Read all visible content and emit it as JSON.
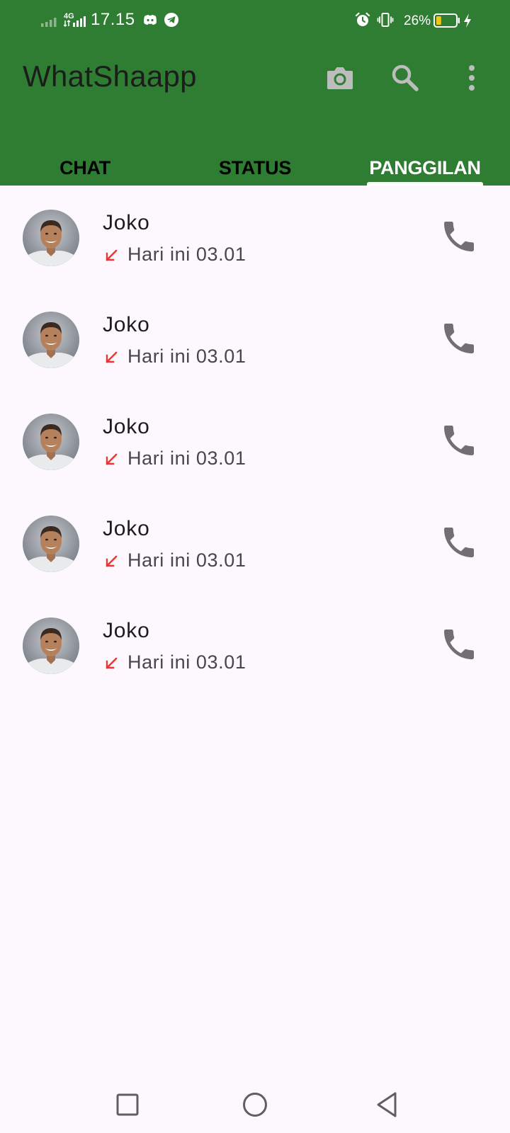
{
  "status_bar": {
    "time": "17.15",
    "network": "4G",
    "battery_percent": "26%",
    "battery_level": 0.26,
    "icons": [
      "signal-bars-icon",
      "network-4g-icon",
      "discord-icon",
      "telegram-icon",
      "alarm-icon",
      "vibrate-icon",
      "battery-icon",
      "charging-icon"
    ]
  },
  "app_bar": {
    "title": "WhatShaapp",
    "actions": [
      "camera-icon",
      "search-icon",
      "more-vert-icon"
    ]
  },
  "tabs": [
    {
      "label": "CHAT",
      "active": false
    },
    {
      "label": "STATUS",
      "active": false
    },
    {
      "label": "PANGGILAN",
      "active": true
    }
  ],
  "calls": [
    {
      "name": "Joko",
      "time": "Hari ini 03.01",
      "direction": "incoming-missed"
    },
    {
      "name": "Joko",
      "time": "Hari ini 03.01",
      "direction": "incoming-missed"
    },
    {
      "name": "Joko",
      "time": "Hari ini 03.01",
      "direction": "incoming-missed"
    },
    {
      "name": "Joko",
      "time": "Hari ini 03.01",
      "direction": "incoming-missed"
    },
    {
      "name": "Joko",
      "time": "Hari ini 03.01",
      "direction": "incoming-missed"
    }
  ],
  "colors": {
    "app_bar": "#2E7D32",
    "background": "#FDF8FD",
    "missed_arrow": "#E53935",
    "call_icon": "#707070"
  },
  "nav_bar": [
    "recents-square-icon",
    "home-circle-icon",
    "back-triangle-icon"
  ]
}
